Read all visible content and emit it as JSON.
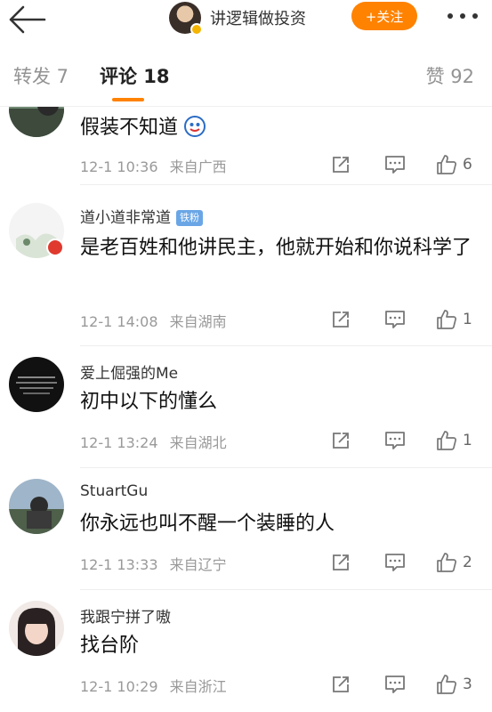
{
  "header": {
    "author_name": "讲逻辑做投资",
    "follow_label": "+关注"
  },
  "tabs": {
    "repost": "转发 7",
    "comment": "评论 18",
    "like": "赞 92"
  },
  "comments": [
    {
      "name": "",
      "text": "假装不知道",
      "emoji": "doge-emoji",
      "time": "12-1 10:36",
      "location": "来自广西",
      "likes": "6"
    },
    {
      "name": "道小道非常道",
      "badge": "铁粉",
      "text": "是老百姓和他讲民主，他就开始和你说科学了",
      "time": "12-1 14:08",
      "location": "来自湖南",
      "likes": "1"
    },
    {
      "name": "爱上倔强的Me",
      "text": "初中以下的懂么",
      "time": "12-1 13:24",
      "location": "来自湖北",
      "likes": "1"
    },
    {
      "name": "StuartGu",
      "text": "你永远也叫不醒一个装睡的人",
      "time": "12-1 13:33",
      "location": "来自辽宁",
      "likes": "2"
    },
    {
      "name": "我跟宁拼了嗷",
      "text": "找台阶",
      "time": "12-1 10:29",
      "location": "来自浙江",
      "likes": "3"
    }
  ],
  "colors": {
    "accent": "#ff8200",
    "muted": "#999999",
    "fan_badge": "#6aa6e6"
  }
}
